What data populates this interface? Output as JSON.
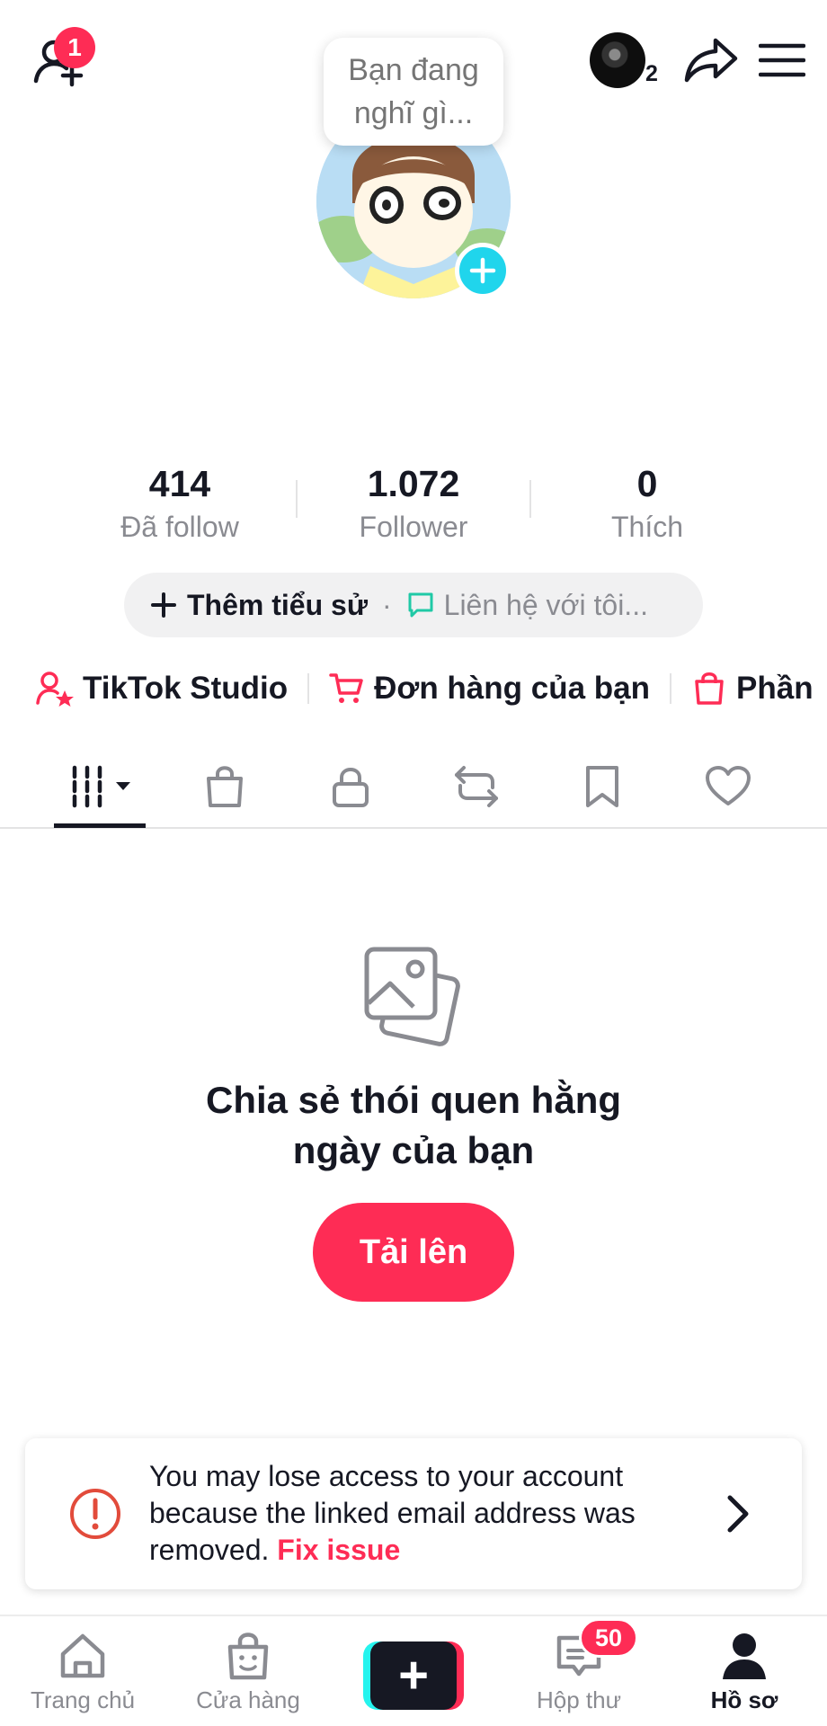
{
  "header": {
    "add_friends_badge": "1",
    "story_avatar_count": "2"
  },
  "profile": {
    "thought_bubble": "Bạn đang nghĩ gì..."
  },
  "stats": [
    {
      "value": "414",
      "label": "Đã follow"
    },
    {
      "value": "1.072",
      "label": "Follower"
    },
    {
      "value": "0",
      "label": "Thích"
    }
  ],
  "bio": {
    "add_label": "Thêm tiểu sử",
    "separator": "·",
    "contact_label": "Liên hệ với tôi..."
  },
  "quick_links": {
    "studio": "TikTok Studio",
    "orders": "Đơn hàng của bạn",
    "rewards": "Phần"
  },
  "tabs": [
    {
      "icon": "grid-videos-icon",
      "active": true
    },
    {
      "icon": "shopping-bag-icon"
    },
    {
      "icon": "lock-icon"
    },
    {
      "icon": "repost-icon"
    },
    {
      "icon": "bookmark-icon"
    },
    {
      "icon": "heart-icon"
    }
  ],
  "empty_state": {
    "icon": "photos-icon",
    "title_line1": "Chia sẻ thói quen hằng",
    "title_line2": "ngày của bạn",
    "upload_label": "Tải lên"
  },
  "alert": {
    "message": "You may lose access to your account because the linked email address was removed.",
    "link": "Fix issue"
  },
  "bottom_nav": {
    "home": "Trang chủ",
    "shop": "Cửa hàng",
    "create": "+",
    "inbox": "Hộp thư",
    "inbox_badge": "50",
    "profile": "Hồ sơ"
  },
  "colors": {
    "accent": "#fe2c55",
    "cyan": "#25f4ee",
    "text": "#161823",
    "muted": "#8a8b91"
  }
}
